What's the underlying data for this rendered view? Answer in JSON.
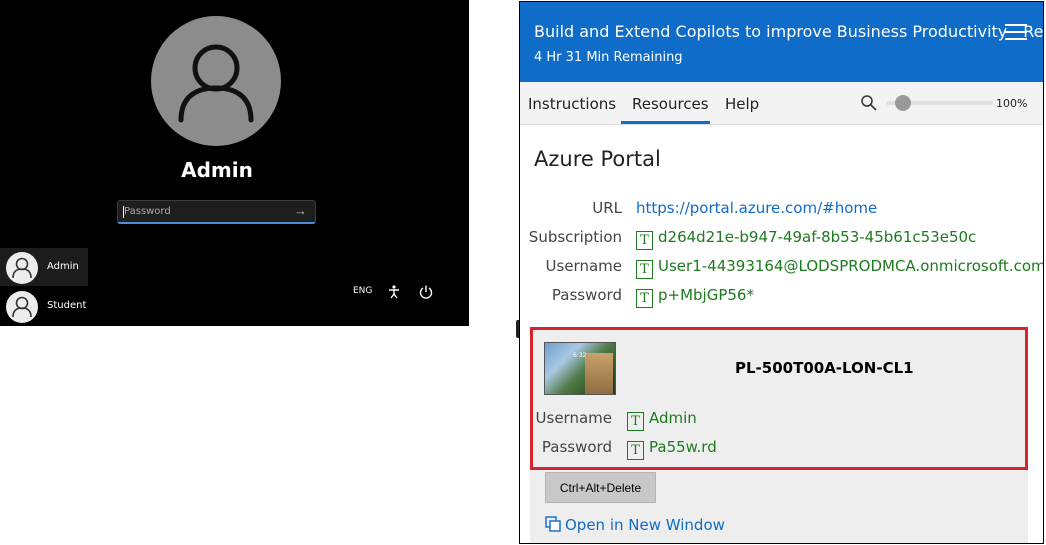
{
  "lock_screen": {
    "user_name": "Admin",
    "password_placeholder": "Password",
    "users": [
      {
        "label": "Admin"
      },
      {
        "label": "Student"
      }
    ],
    "tray": {
      "language": "ENG"
    }
  },
  "lab_panel": {
    "title": "Build and Extend Copilots to improve Business Productivity - Regi...",
    "time_remaining": "4 Hr 31 Min Remaining",
    "tabs": [
      {
        "label": "Instructions"
      },
      {
        "label": "Resources"
      },
      {
        "label": "Help"
      }
    ],
    "active_tab": "Resources",
    "zoom": {
      "value_label": "100%",
      "level": 0.1
    },
    "section_title": "Azure Portal",
    "credentials": {
      "url_label": "URL",
      "url_value": "https://portal.azure.com/#home",
      "subscription_label": "Subscription",
      "subscription_value": "d264d21e-b947-49af-8b53-45b61c53e50c",
      "username_label": "Username",
      "username_value": "User1-44393164@LODSPRODMCA.onmicrosoft.com",
      "password_label": "Password",
      "password_value": "p+MbjGP56*"
    },
    "vm": {
      "name": "PL-500T00A-LON-CL1",
      "thumbnail_time": "6:32",
      "username_label": "Username",
      "username_value": "Admin",
      "password_label": "Password",
      "password_value": "Pa55w.rd",
      "cad_label": "Ctrl+Alt+Delete",
      "open_new_label": "Open in New Window"
    },
    "type_icon_glyph": "T",
    "colors": {
      "header": "#0f6cc9",
      "highlight_border": "#d9232d",
      "credential_text": "#1e7a1e"
    }
  }
}
